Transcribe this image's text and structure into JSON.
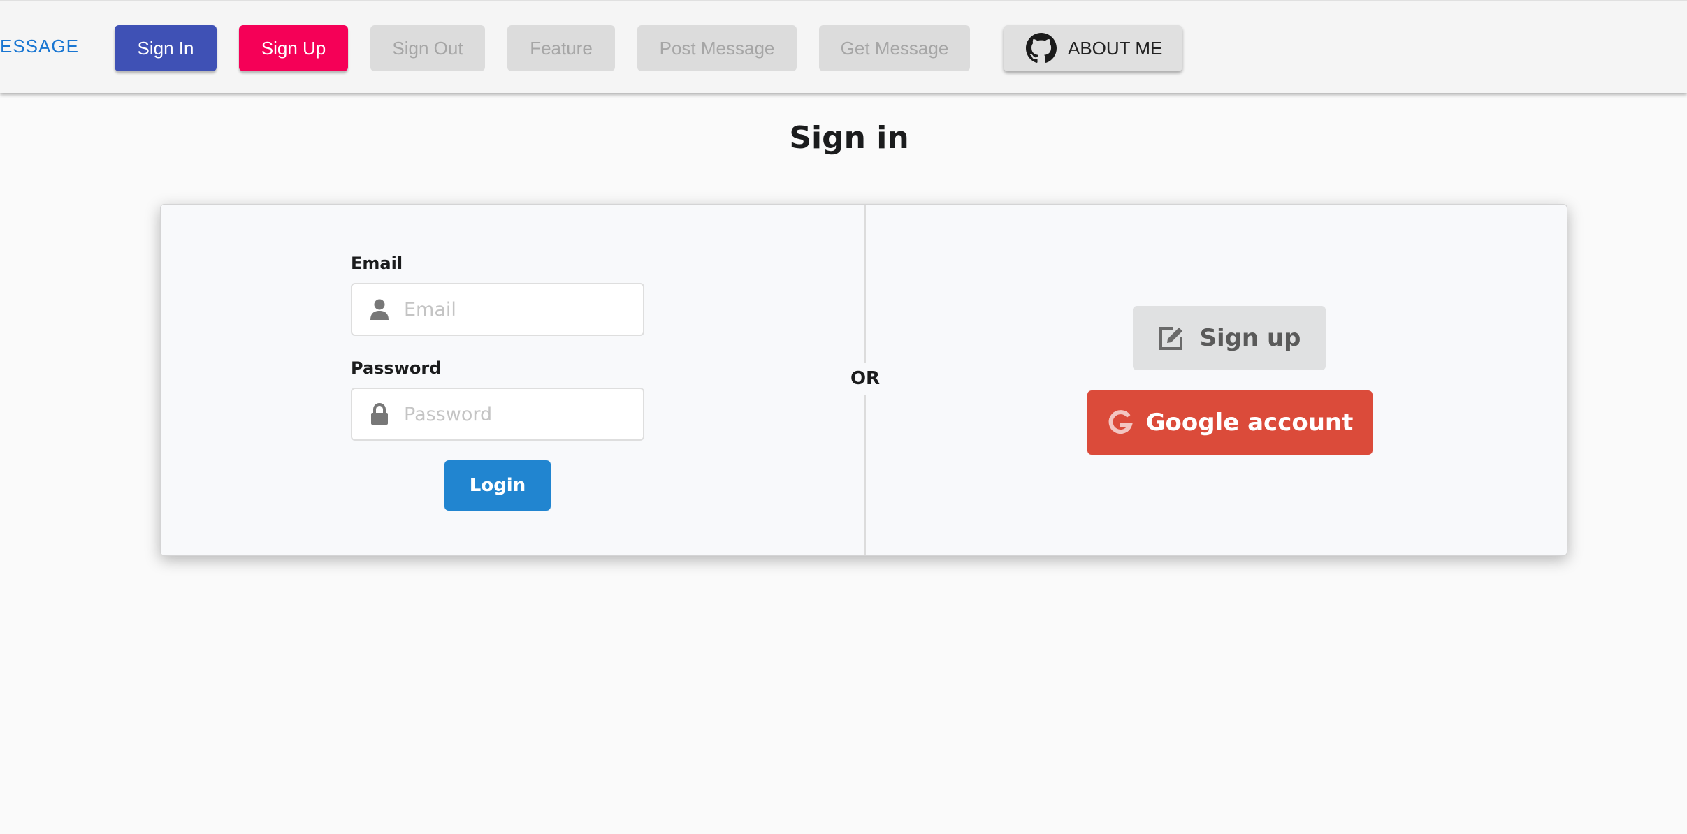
{
  "nav": {
    "brand": "ESSAGE",
    "buttons": {
      "sign_in": "Sign In",
      "sign_up": "Sign Up",
      "sign_out": "Sign Out",
      "feature": "Feature",
      "post_message": "Post Message",
      "get_message": "Get Message",
      "about_me": "ABOUT ME"
    },
    "icons": {
      "about_me": "github-icon"
    }
  },
  "main": {
    "title": "Sign in",
    "form": {
      "email_label": "Email",
      "email_placeholder": "Email",
      "email_value": "",
      "password_label": "Password",
      "password_placeholder": "Password",
      "password_value": "",
      "login_label": "Login",
      "icons": {
        "email": "user-icon",
        "password": "lock-icon"
      }
    },
    "divider_label": "OR",
    "alt": {
      "signup_label": "Sign up",
      "google_label": "Google account",
      "icons": {
        "signup": "edit-icon",
        "google": "google-icon"
      }
    }
  },
  "colors": {
    "brand": "#1976d2",
    "sign_in": "#3f51b5",
    "sign_up": "#f50057",
    "disabled": "#dcdcdc",
    "login": "#2185d0",
    "google": "#db4b3a"
  }
}
